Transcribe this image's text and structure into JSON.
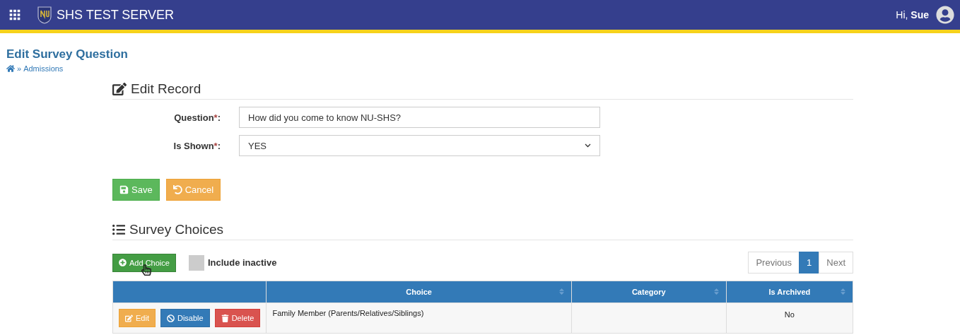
{
  "header": {
    "title": "SHS TEST SERVER",
    "greeting": "Hi,",
    "user": "Sue"
  },
  "page": {
    "title": "Edit Survey Question",
    "breadcrumb": [
      {
        "separator": "»",
        "label": "Admissions"
      }
    ]
  },
  "edit_record": {
    "heading": "Edit Record",
    "fields": [
      {
        "kind": "text",
        "label": "Question",
        "required_mark": "*",
        "suffix": ":",
        "value": "How did you come to know NU-SHS?"
      },
      {
        "kind": "select",
        "label": "Is Shown",
        "required_mark": "*",
        "suffix": ":",
        "value": "YES"
      }
    ],
    "buttons": [
      {
        "kind": "save",
        "label": "Save"
      },
      {
        "kind": "cancel",
        "label": "Cancel"
      }
    ]
  },
  "survey_choices": {
    "heading": "Survey Choices",
    "add_button": "Add Choice",
    "include_inactive": {
      "label": "Include inactive",
      "checked": false
    },
    "pagination": [
      {
        "label": "Previous",
        "selected": false
      },
      {
        "label": "1",
        "selected": true
      },
      {
        "label": "Next",
        "selected": false
      }
    ],
    "columns": [
      {
        "label": "Choice",
        "sortable": true
      },
      {
        "label": "Category",
        "sortable": true
      },
      {
        "label": "Is Archived",
        "sortable": true
      }
    ],
    "rows": [
      {
        "actions": [
          {
            "kind": "edit",
            "label": "Edit"
          },
          {
            "kind": "disable",
            "label": "Disable"
          },
          {
            "kind": "delete",
            "label": "Delete"
          }
        ],
        "choice": "Family Member (Parents/Relatives/Siblings)",
        "is_archived": "No"
      }
    ]
  }
}
